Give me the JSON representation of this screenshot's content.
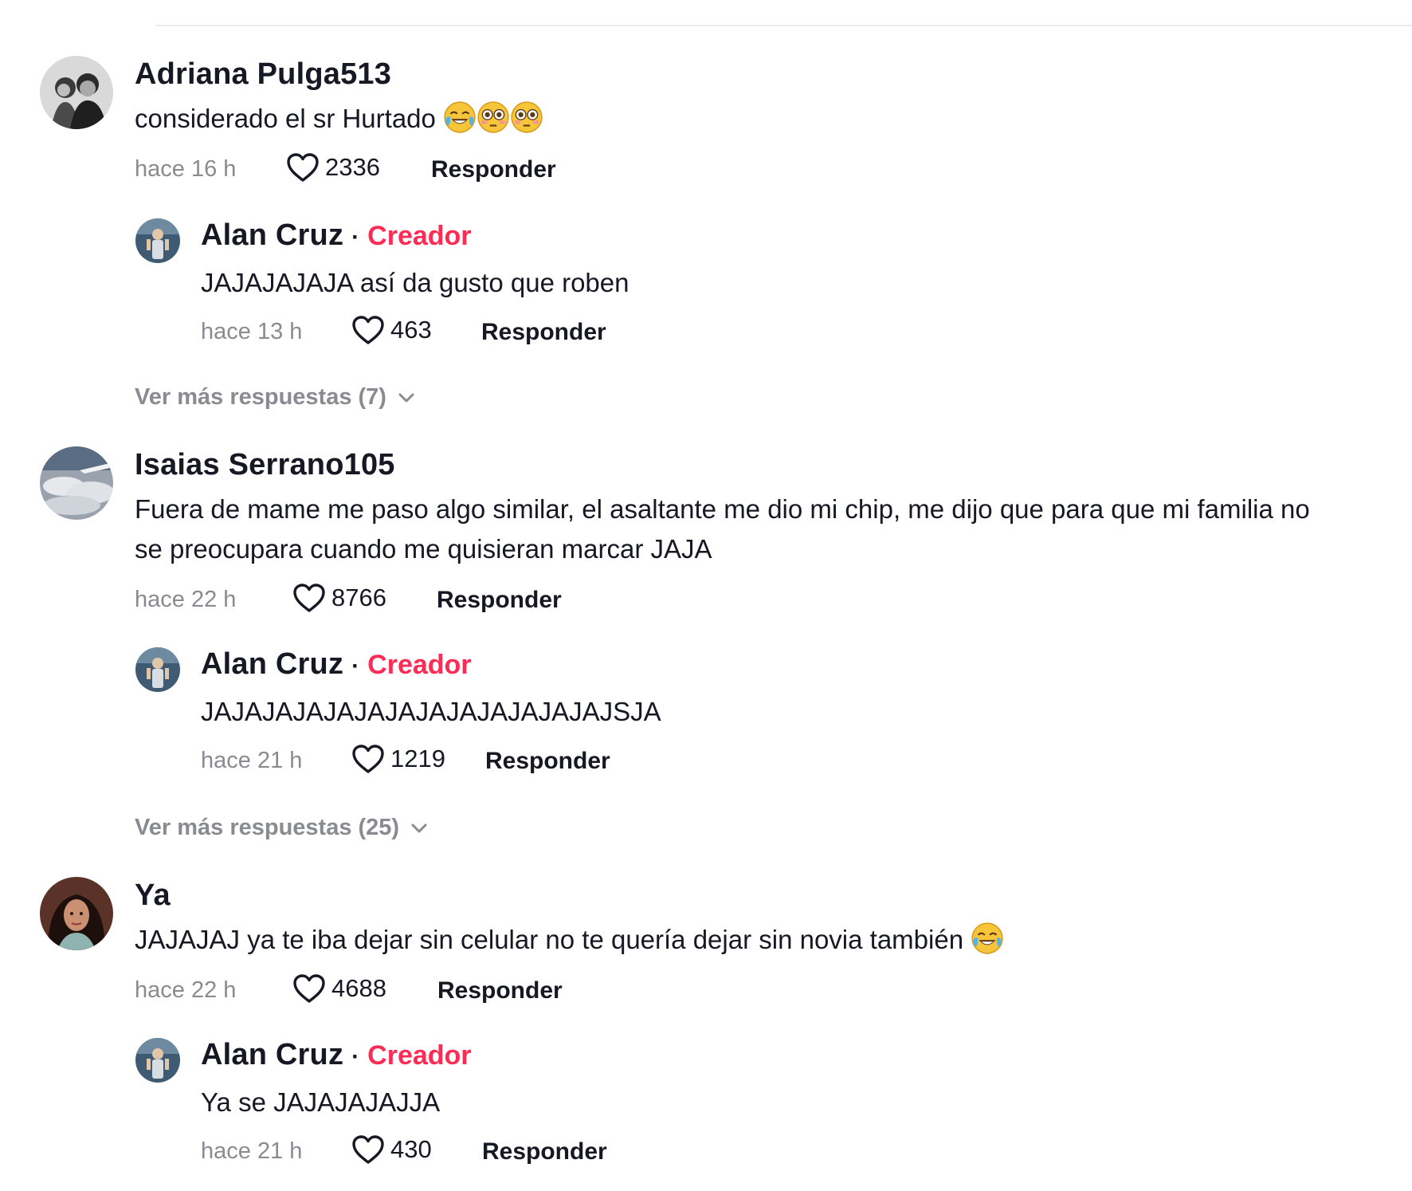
{
  "threads": [
    {
      "author": "Adriana Pulga513",
      "text": "considerado el sr Hurtado",
      "emojis": [
        "joy-emoji",
        "flushed-emoji",
        "flushed-emoji"
      ],
      "time": "hace 16 h",
      "likes": "2336",
      "reply_label": "Responder",
      "reply": {
        "author": "Alan Cruz",
        "dot": "·",
        "badge": "Creador",
        "text": "JAJAJAJAJA así da gusto que roben",
        "time": "hace 13 h",
        "likes": "463",
        "reply_label": "Responder"
      },
      "more_replies": "Ver más respuestas (7)"
    },
    {
      "author": "Isaias Serrano105",
      "text_line1": "Fuera de mame me paso algo similar, el asaltante me dio mi chip, me dijo que para que mi familia no",
      "text_line2": "se preocupara cuando me quisieran marcar JAJA",
      "time": "hace 22 h",
      "likes": "8766",
      "reply_label": "Responder",
      "reply": {
        "author": "Alan Cruz",
        "dot": "·",
        "badge": "Creador",
        "text": "JAJAJAJAJAJAJAJAJAJAJAJAJAJSJA",
        "time": "hace 21 h",
        "likes": "1219",
        "reply_label": "Responder"
      },
      "more_replies": "Ver más respuestas (25)"
    },
    {
      "author": "Ya",
      "text": "JAJAJAJ ya te iba dejar sin celular no te quería dejar sin novia también",
      "emojis": [
        "joy-emoji"
      ],
      "time": "hace 22 h",
      "likes": "4688",
      "reply_label": "Responder",
      "reply": {
        "author": "Alan Cruz",
        "dot": "·",
        "badge": "Creador",
        "text": "Ya se JAJAJAJAJJA",
        "time": "hace 21 h",
        "likes": "430",
        "reply_label": "Responder"
      }
    }
  ],
  "colors": {
    "creator_badge": "#fe2c55",
    "muted_text": "#8a8b91",
    "primary_text": "#161823"
  }
}
